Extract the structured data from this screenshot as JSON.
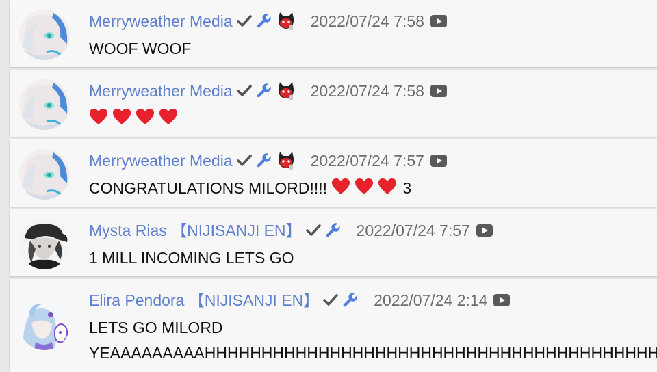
{
  "messages": [
    {
      "author": "Merryweather Media",
      "timestamp": "2022/07/24 7:58",
      "badges": [
        "verified-check-icon",
        "moderator-wrench-icon",
        "member-badge-icon"
      ],
      "text": "WOOF WOOF",
      "avatar": "merryweather-avatar"
    },
    {
      "author": "Merryweather Media",
      "timestamp": "2022/07/24 7:58",
      "badges": [
        "verified-check-icon",
        "moderator-wrench-icon",
        "member-badge-icon"
      ],
      "text": "",
      "hearts": 4,
      "avatar": "merryweather-avatar"
    },
    {
      "author": "Merryweather Media",
      "timestamp": "2022/07/24 7:57",
      "badges": [
        "verified-check-icon",
        "moderator-wrench-icon",
        "member-badge-icon"
      ],
      "text": "CONGRATULATIONS MILORD!!!!",
      "hearts": 3,
      "text_tail": "3",
      "avatar": "merryweather-avatar"
    },
    {
      "author": "Mysta Rias 【NIJISANJI EN】",
      "timestamp": "2022/07/24 7:57",
      "badges": [
        "verified-check-icon",
        "moderator-wrench-icon"
      ],
      "text": "1 MILL INCOMING LETS GO",
      "avatar": "mysta-avatar"
    },
    {
      "author": "Elira Pendora 【NIJISANJI EN】",
      "timestamp": "2022/07/24 2:14",
      "badges": [
        "verified-check-icon",
        "moderator-wrench-icon"
      ],
      "text": "LETS GO MILORD",
      "text_line2": "YEAAAAAAAAAHHHHHHHHHHHHHHHHHHHHHHHHHHHHHHHHHHHHHHHHHHHHHHH",
      "avatar": "elira-avatar"
    }
  ],
  "icons": {
    "platform": "youtube-icon",
    "heart": "heart-icon"
  },
  "colors": {
    "author": "#5f7fcf",
    "timestamp": "#6d6d6d",
    "wrench": "#4f7fe0",
    "heart": "#e8222d",
    "card": "#f7f7f7"
  }
}
